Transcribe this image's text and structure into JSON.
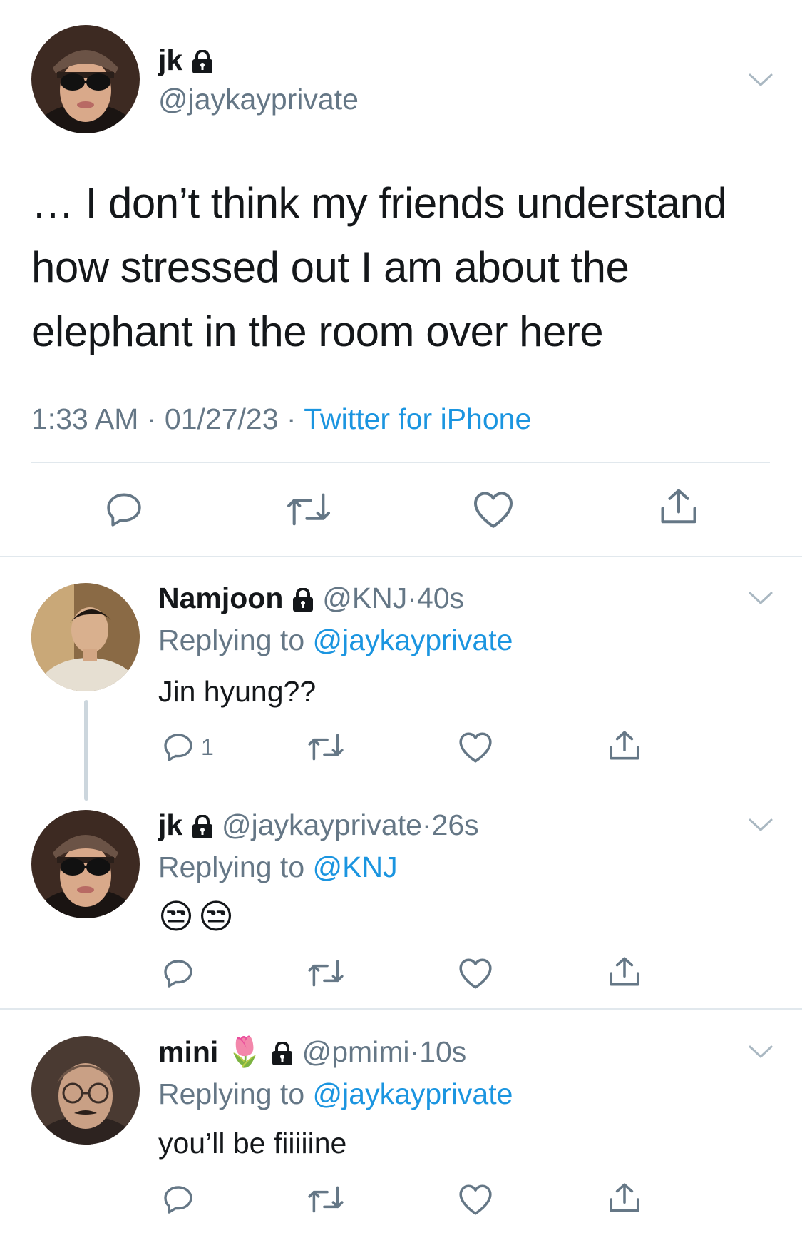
{
  "main_tweet": {
    "display_name": "jk",
    "handle": "@jaykayprivate",
    "text_lines": [
      "… I don’t think my friends understand",
      "how stressed out I am about the",
      "elephant in the room over here"
    ],
    "time": "1:33 AM",
    "sep1": "·",
    "date": "01/27/23",
    "sep2": "·",
    "source": "Twitter for iPhone"
  },
  "replies": [
    {
      "display_name": "Namjoon",
      "handle": "@KNJ",
      "dot": "·",
      "age": "40s",
      "replying_prefix": "Replying to",
      "replying_handle": "@jaykayprivate",
      "text": "Jin hyung??",
      "reply_count": "1"
    },
    {
      "display_name": "jk",
      "handle": "@jaykayprivate",
      "dot": "·",
      "age": "26s",
      "replying_prefix": "Replying to",
      "replying_handle": "@KNJ",
      "text": "😒😒",
      "reply_count": ""
    },
    {
      "display_name": "mini",
      "name_emoji": "🌷",
      "handle": "@pmimi",
      "dot": "·",
      "age": "10s",
      "replying_prefix": "Replying to",
      "replying_handle": "@jaykayprivate",
      "text": "you’ll be fiiiiine",
      "reply_count": ""
    }
  ],
  "icons": {
    "reply": "reply-icon",
    "retweet": "retweet-icon",
    "like": "heart-icon",
    "share": "share-icon",
    "lock": "lock-icon",
    "chevron": "chevron-down-icon"
  },
  "colors": {
    "link_blue": "#1b95e0",
    "secondary_gray": "#657786",
    "divider": "#e1e8ed"
  }
}
